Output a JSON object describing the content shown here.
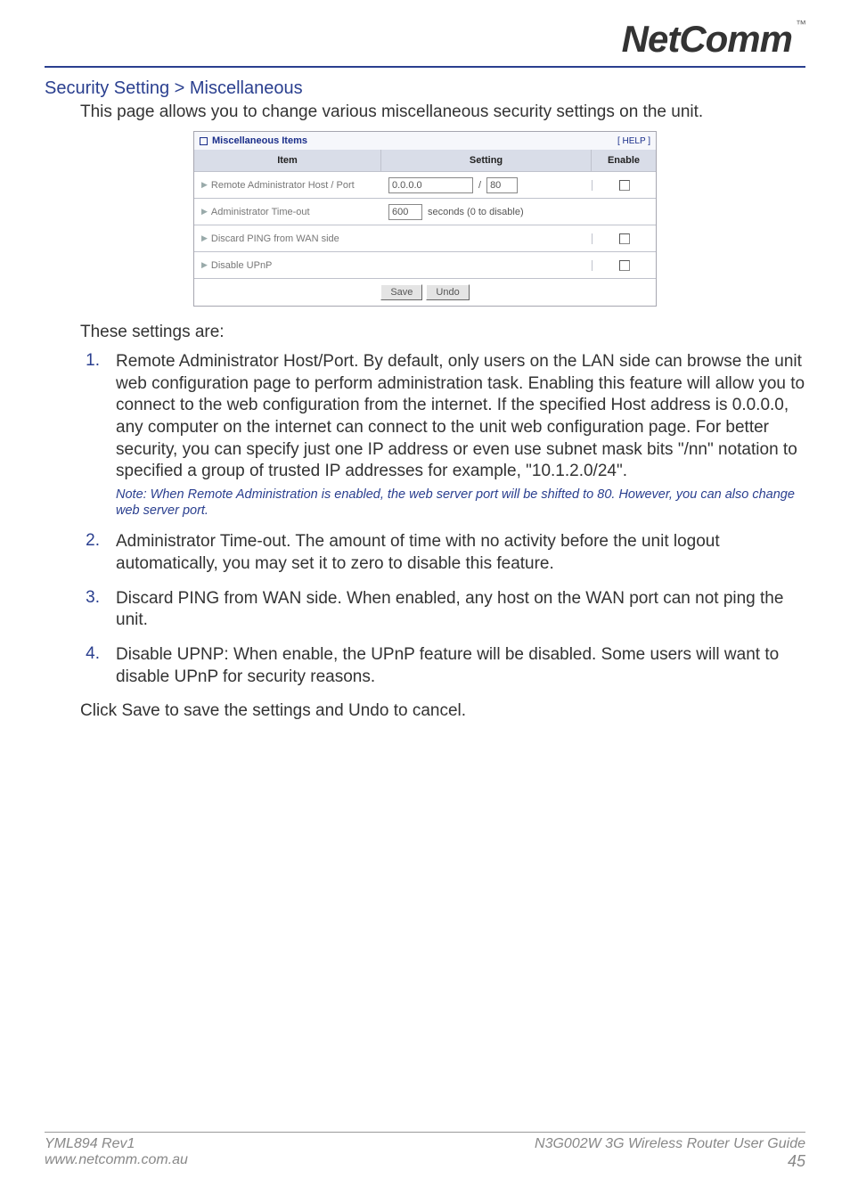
{
  "logo": {
    "text": "NetComm",
    "tm": "™"
  },
  "section_title": "Security Setting > Miscellaneous",
  "intro": "This page allows you to change various miscellaneous security settings on the unit.",
  "panel": {
    "title": "Miscellaneous Items",
    "help": "[ HELP ]",
    "headers": {
      "item": "Item",
      "setting": "Setting",
      "enable": "Enable"
    },
    "rows": [
      {
        "label": "Remote Administrator Host / Port",
        "host": "0.0.0.0",
        "sep": "/",
        "port": "80",
        "has_enable": true
      },
      {
        "label": "Administrator Time-out",
        "timeout": "600",
        "suffix": "seconds (0 to disable)",
        "has_enable": false
      },
      {
        "label": "Discard PING from WAN side",
        "has_enable": true
      },
      {
        "label": "Disable UPnP",
        "has_enable": true
      }
    ],
    "buttons": {
      "save": "Save",
      "undo": "Undo"
    }
  },
  "lead_in": "These settings are:",
  "items": [
    {
      "num": "1.",
      "text": "Remote Administrator Host/Port. By default, only users on the LAN side can browse the unit web configuration page to perform administration task. Enabling this feature will allow you to connect to the web configuration from the internet. If the specified Host address is 0.0.0.0, any computer on the internet can connect to the unit web configuration page. For better security, you can specify just one IP address or even use subnet mask bits \"/nn\" notation to specified a group of trusted IP addresses for example, \"10.1.2.0/24\".",
      "note": "Note: When Remote Administration is enabled, the web server port will be shifted to 80. However, you can also change web server port."
    },
    {
      "num": "2.",
      "text": "Administrator Time-out. The amount of time with no activity before the unit logout automatically, you may set it to zero to disable this feature."
    },
    {
      "num": "3.",
      "text": "Discard PING from WAN side. When enabled, any host on the WAN port can not ping the unit."
    },
    {
      "num": "4.",
      "text": "Disable UPNP: When enable, the UPnP feature will be disabled. Some users will want to disable UPnP for security reasons."
    }
  ],
  "closing": "Click Save to save the settings and Undo to cancel.",
  "footer": {
    "left1": "YML894 Rev1",
    "left2": "www.netcomm.com.au",
    "right1": "N3G002W 3G Wireless Router User Guide",
    "right2": "45"
  }
}
